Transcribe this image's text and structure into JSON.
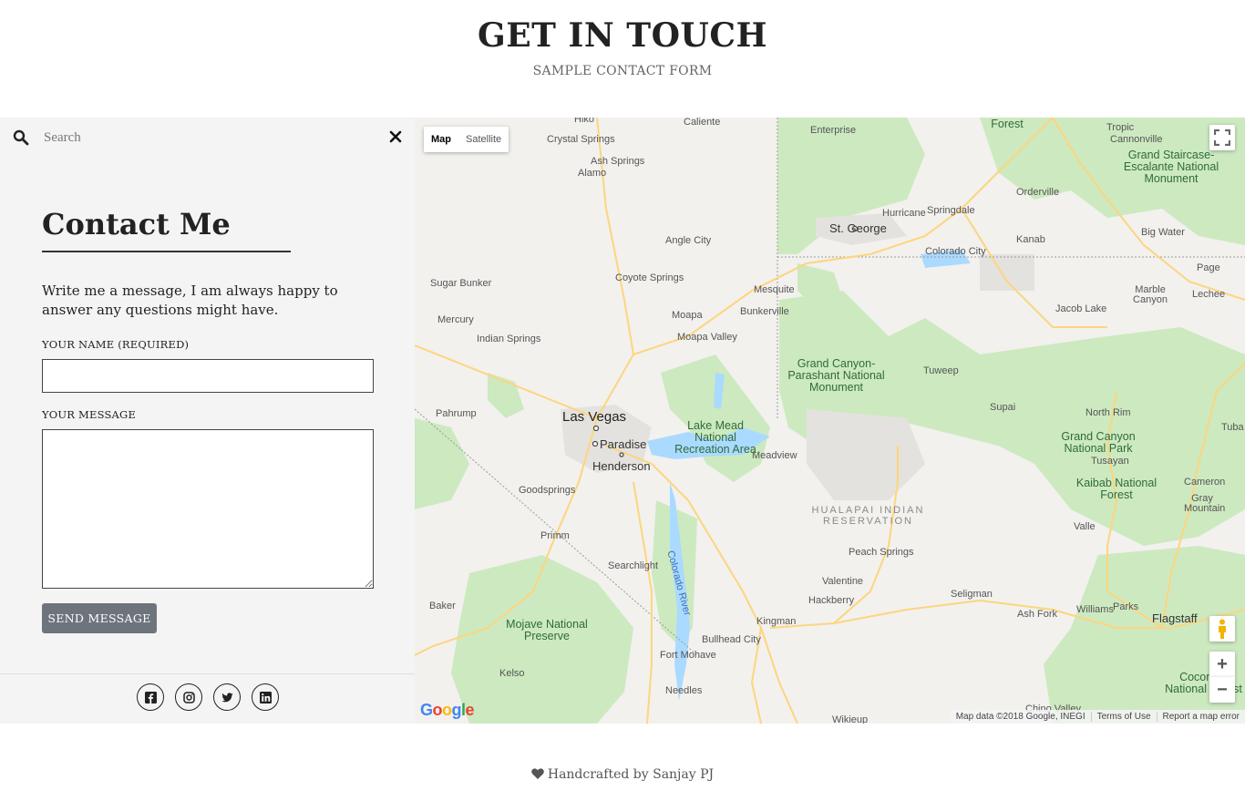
{
  "header": {
    "title": "GET IN TOUCH",
    "subtitle": "SAMPLE CONTACT FORM"
  },
  "sidebar": {
    "search_placeholder": "Search",
    "search_value": "",
    "heading": "Contact Me",
    "intro": "Write me a message, I am always happy to answer any questions might have.",
    "name_label": "YOUR NAME (REQUIRED)",
    "name_value": "",
    "message_label": "YOUR MESSAGE",
    "message_value": "",
    "send_label": "SEND MESSAGE",
    "social_icons": [
      "facebook-icon",
      "instagram-icon",
      "twitter-icon",
      "linkedin-icon"
    ]
  },
  "map": {
    "type_buttons": {
      "map": "Map",
      "satellite": "Satellite"
    },
    "active_type": "Map",
    "zoom_in": "+",
    "zoom_out": "−",
    "logo": "Google",
    "attribution": {
      "data": "Map data ©2018 Google, INEGI",
      "terms": "Terms of Use",
      "report": "Report a map error"
    },
    "major_labels": [
      "Las Vegas",
      "Paradise",
      "Henderson",
      "St. George",
      "Flagstaff",
      "Kingman",
      "Bullhead City"
    ],
    "places": [
      "Hiko",
      "Caliente",
      "Crystal Springs",
      "Ash Springs",
      "Alamo",
      "Angle City",
      "Coyote Springs",
      "Sugar Bunker",
      "Mercury",
      "Indian Springs",
      "Pahrump",
      "Moapa",
      "Moapa Valley",
      "Mesquite",
      "Bunkerville",
      "Goodsprings",
      "Primm",
      "Searchlight",
      "Baker",
      "Kelso",
      "Fort Mohave",
      "Needles",
      "Meadview",
      "Peach Springs",
      "Valentine",
      "Hackberry",
      "Seligman",
      "Ash Fork",
      "Williams",
      "Parks",
      "Tusayan",
      "Valle",
      "Cameron",
      "Gray Mountain",
      "North Rim",
      "Supai",
      "Tuweep",
      "Jacob Lake",
      "Kanab",
      "Big Water",
      "Page",
      "Lechee",
      "Marble Canyon",
      "Enterprise",
      "Hurricane",
      "Springdale",
      "Colorado City",
      "Orderville",
      "Tropic",
      "Cannonville",
      "Chino Valley",
      "Wikieup",
      "Tuba"
    ],
    "parks": [
      "Lake Mead National Recreation Area",
      "Grand Canyon-Parashant National Monument",
      "Grand Staircase-Escalante National Monument",
      "Grand Canyon National Park",
      "Kaibab National Forest",
      "Mojave National Preserve",
      "Coconino National Forest",
      "Forest"
    ],
    "reservation": "HUALAPAI INDIAN RESERVATION",
    "river": "Colorado River",
    "colors": {
      "land": "#f2f1ee",
      "park": "#cde9c0",
      "road": "#fdd57e",
      "water": "#aadaff"
    }
  },
  "footer": {
    "text": "Handcrafted by Sanjay PJ"
  }
}
